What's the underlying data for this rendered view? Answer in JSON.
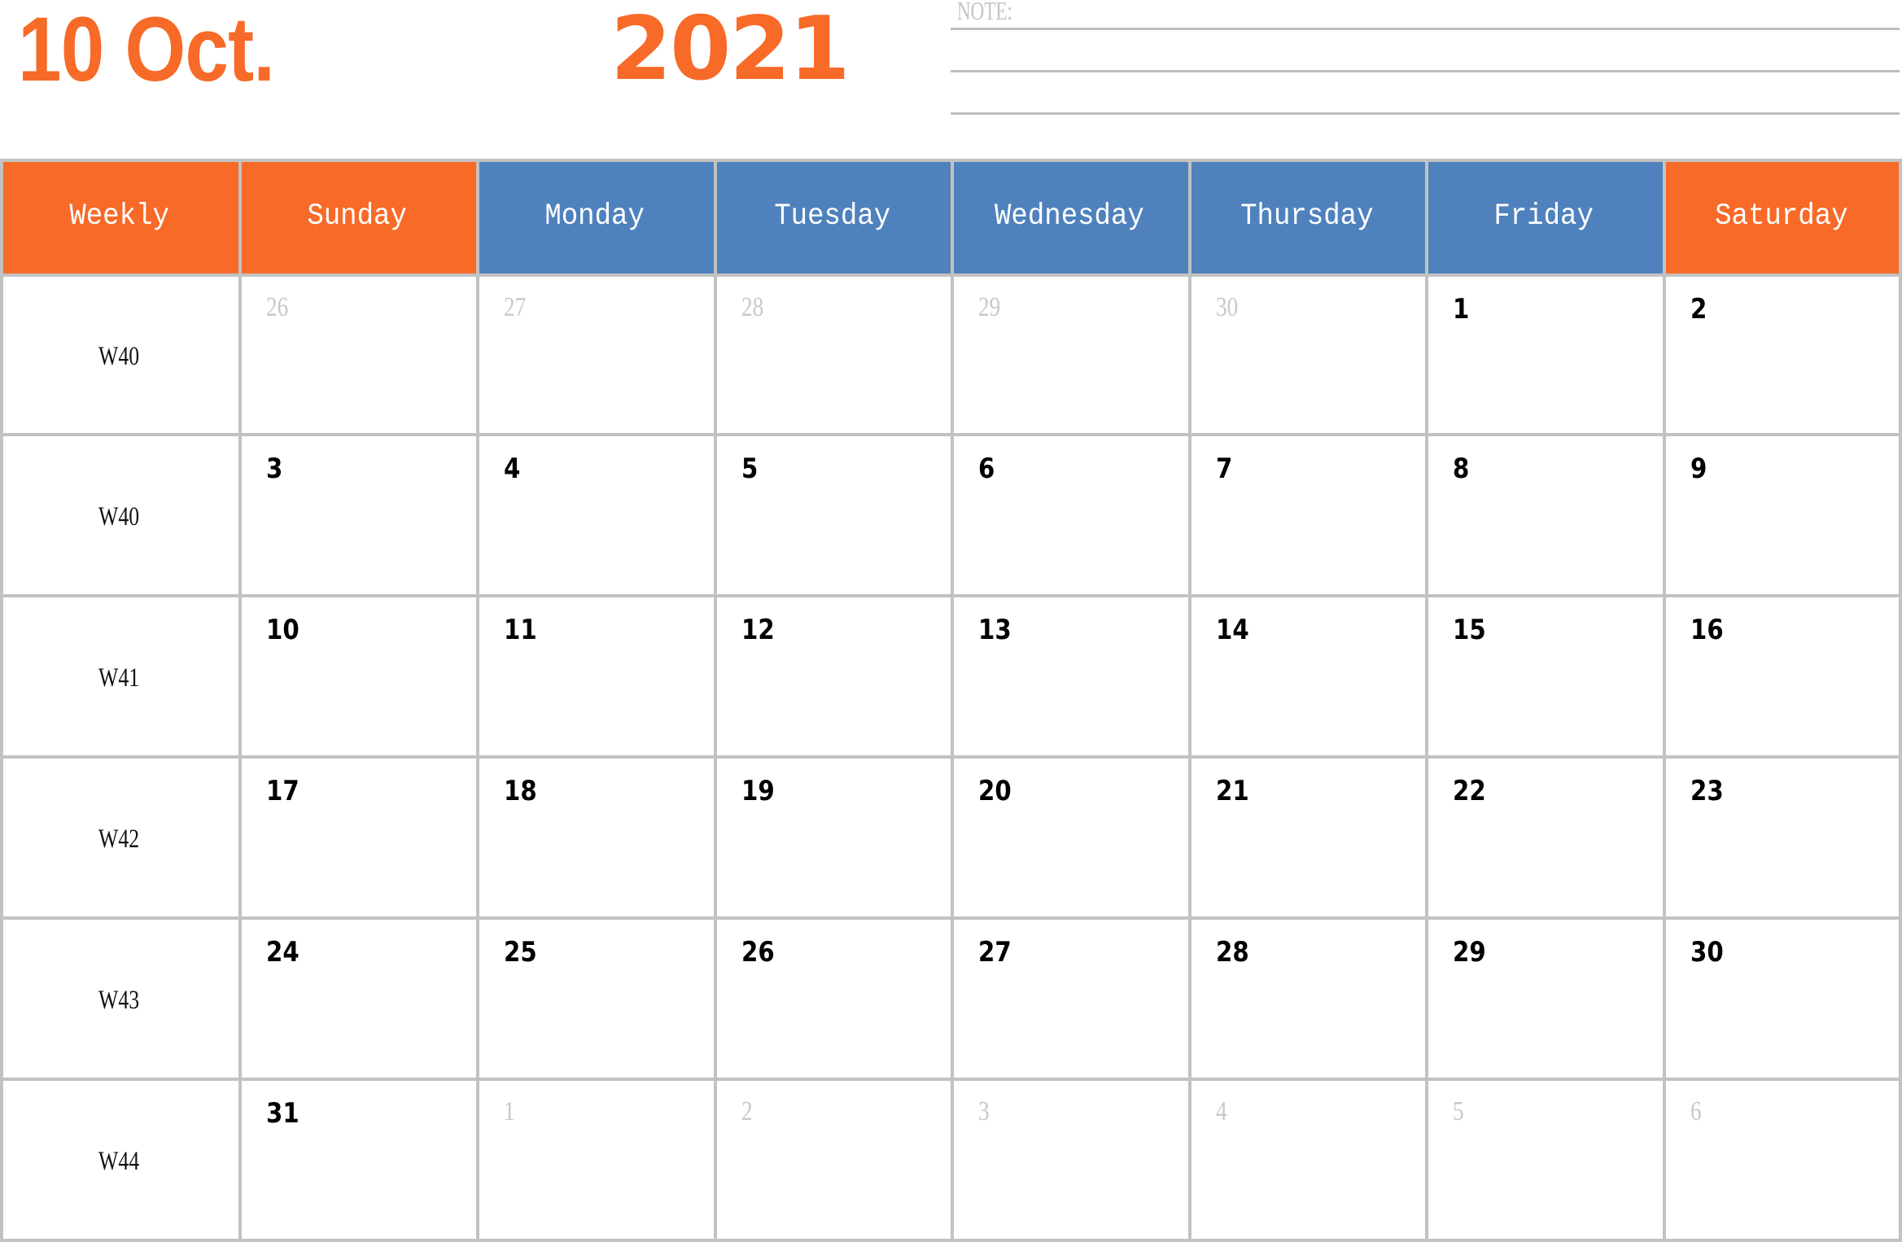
{
  "title": {
    "month_label": "10 Oct.",
    "year": "2021",
    "accent_color": "#f76a28"
  },
  "notes": {
    "label": "NOTE:",
    "line_count": 3
  },
  "header": {
    "columns": [
      {
        "label": "Weekly",
        "color": "#f76a28"
      },
      {
        "label": "Sunday",
        "color": "#f76a28"
      },
      {
        "label": "Monday",
        "color": "#4f81bd"
      },
      {
        "label": "Tuesday",
        "color": "#4f81bd"
      },
      {
        "label": "Wednesday",
        "color": "#4f81bd"
      },
      {
        "label": "Thursday",
        "color": "#4f81bd"
      },
      {
        "label": "Friday",
        "color": "#4f81bd"
      },
      {
        "label": "Saturday",
        "color": "#f76a28"
      }
    ]
  },
  "weeks": [
    {
      "label": "W40",
      "days": [
        {
          "num": "26",
          "current": false
        },
        {
          "num": "27",
          "current": false
        },
        {
          "num": "28",
          "current": false
        },
        {
          "num": "29",
          "current": false
        },
        {
          "num": "30",
          "current": false
        },
        {
          "num": "1",
          "current": true
        },
        {
          "num": "2",
          "current": true
        }
      ]
    },
    {
      "label": "W40",
      "days": [
        {
          "num": "3",
          "current": true
        },
        {
          "num": "4",
          "current": true
        },
        {
          "num": "5",
          "current": true
        },
        {
          "num": "6",
          "current": true
        },
        {
          "num": "7",
          "current": true
        },
        {
          "num": "8",
          "current": true
        },
        {
          "num": "9",
          "current": true
        }
      ]
    },
    {
      "label": "W41",
      "days": [
        {
          "num": "10",
          "current": true
        },
        {
          "num": "11",
          "current": true
        },
        {
          "num": "12",
          "current": true
        },
        {
          "num": "13",
          "current": true
        },
        {
          "num": "14",
          "current": true
        },
        {
          "num": "15",
          "current": true
        },
        {
          "num": "16",
          "current": true
        }
      ]
    },
    {
      "label": "W42",
      "days": [
        {
          "num": "17",
          "current": true
        },
        {
          "num": "18",
          "current": true
        },
        {
          "num": "19",
          "current": true
        },
        {
          "num": "20",
          "current": true
        },
        {
          "num": "21",
          "current": true
        },
        {
          "num": "22",
          "current": true
        },
        {
          "num": "23",
          "current": true
        }
      ]
    },
    {
      "label": "W43",
      "days": [
        {
          "num": "24",
          "current": true
        },
        {
          "num": "25",
          "current": true
        },
        {
          "num": "26",
          "current": true
        },
        {
          "num": "27",
          "current": true
        },
        {
          "num": "28",
          "current": true
        },
        {
          "num": "29",
          "current": true
        },
        {
          "num": "30",
          "current": true
        }
      ]
    },
    {
      "label": "W44",
      "days": [
        {
          "num": "31",
          "current": true
        },
        {
          "num": "1",
          "current": false
        },
        {
          "num": "2",
          "current": false
        },
        {
          "num": "3",
          "current": false
        },
        {
          "num": "4",
          "current": false
        },
        {
          "num": "5",
          "current": false
        },
        {
          "num": "6",
          "current": false
        }
      ]
    }
  ]
}
